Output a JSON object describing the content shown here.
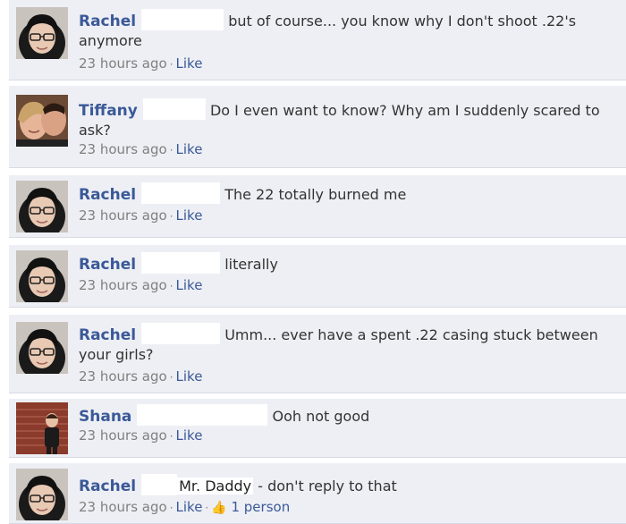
{
  "colors": {
    "comment_bg": "#edeff4",
    "link_blue": "#3b5998",
    "meta_gray": "#808080",
    "text": "#333333"
  },
  "comments": [
    {
      "author": "Rachel",
      "text": "but of course... you know why I don't shoot .22's anymore",
      "time": "23 hours ago",
      "like_label": "Like",
      "avatar_icon": "woman-with-glasses-avatar"
    },
    {
      "author": "Tiffany",
      "text": "Do I even want to know? Why am I suddenly scared to ask?",
      "time": "23 hours ago",
      "like_label": "Like",
      "avatar_icon": "couple-photo-avatar"
    },
    {
      "author": "Rachel",
      "text": "The 22 totally burned me",
      "time": "23 hours ago",
      "like_label": "Like",
      "avatar_icon": "woman-with-glasses-avatar"
    },
    {
      "author": "Rachel",
      "text": "literally",
      "time": "23 hours ago",
      "like_label": "Like",
      "avatar_icon": "woman-with-glasses-avatar"
    },
    {
      "author": "Rachel",
      "text": "Umm... ever have a spent .22 casing stuck between your girls?",
      "time": "23 hours ago",
      "like_label": "Like",
      "avatar_icon": "woman-with-glasses-avatar"
    },
    {
      "author": "Shana",
      "text": "Ooh not good",
      "time": "23 hours ago",
      "like_label": "Like",
      "avatar_icon": "child-brick-wall-avatar"
    },
    {
      "author": "Rachel",
      "mention": "Mr. Daddy",
      "text": "- don't reply to that",
      "time": "23 hours ago",
      "like_label": "Like",
      "likes_count": "1 person",
      "avatar_icon": "woman-with-glasses-avatar"
    }
  ],
  "meta_separator": "·",
  "thumb_glyph": "👍"
}
